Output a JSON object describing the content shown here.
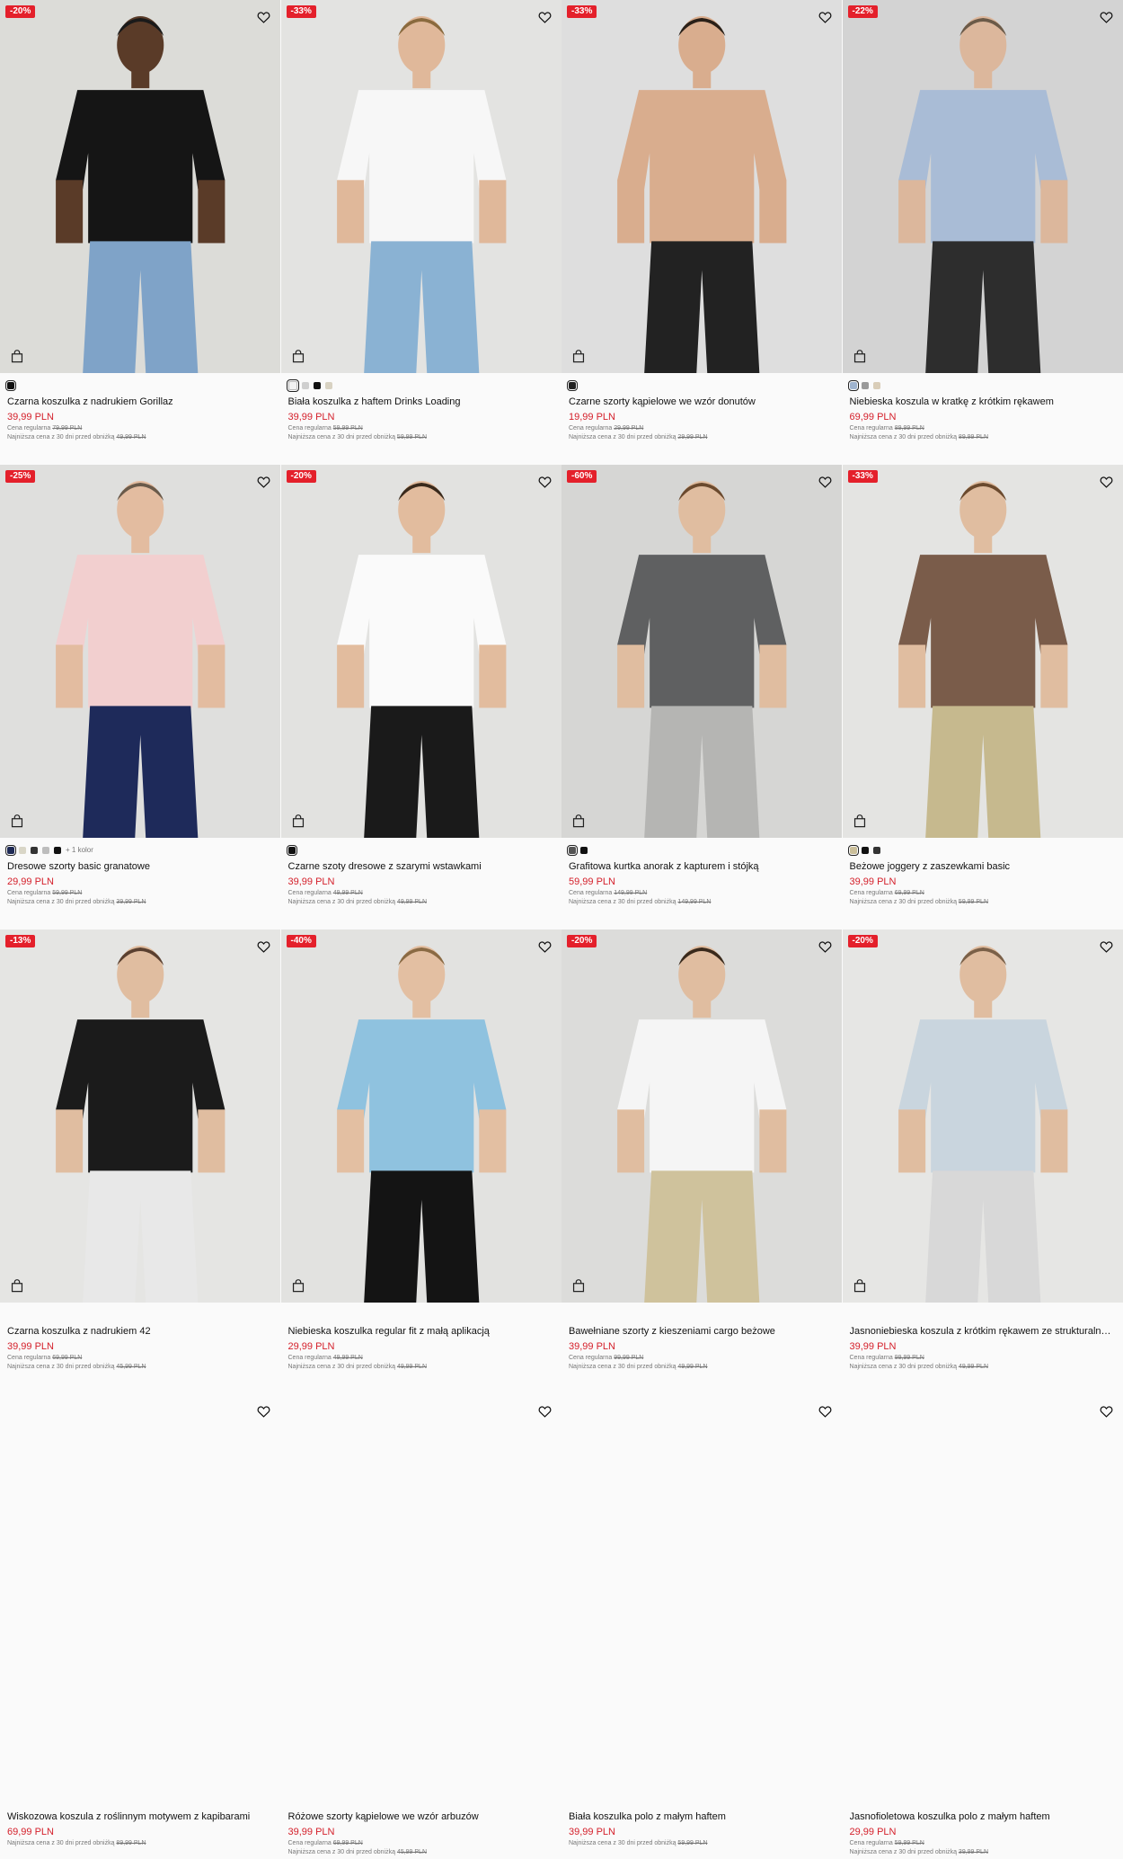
{
  "labels": {
    "regular": "Cena regularna",
    "lowest": "Najniższa cena z 30 dni przed obniżką"
  },
  "products": [
    {
      "badge": "-20%",
      "name": "Czarna koszulka z nadrukiem Gorillaz",
      "price": "39,99 PLN",
      "regular": "79,99 PLN",
      "lowest": "49,99 PLN",
      "swatches": [
        "#111111"
      ],
      "more": "",
      "bg": "#dcdcd8",
      "top": "#151515",
      "bottom": "#7fa3c8",
      "skin": "#5a3b28",
      "hair": "#1a1a1a"
    },
    {
      "badge": "-33%",
      "name": "Biała koszulka z haftem Drinks Loading",
      "price": "39,99 PLN",
      "regular": "59,99 PLN",
      "lowest": "59,99 PLN",
      "swatches": [
        "#f2f2f2",
        "#cfcfcf",
        "#111111",
        "#d8d2c2"
      ],
      "more": "",
      "bg": "#e3e3e1",
      "top": "#f7f7f7",
      "bottom": "#8ab2d3",
      "skin": "#e0b89a",
      "hair": "#8a6a3e"
    },
    {
      "badge": "-33%",
      "name": "Czarne szorty kąpielowe we wzór donutów",
      "price": "19,99 PLN",
      "regular": "29,99 PLN",
      "lowest": "29,99 PLN",
      "swatches": [
        "#222222"
      ],
      "more": "",
      "bg": "#dedede",
      "top": "#d9ad8e",
      "bottom": "#222222",
      "skin": "#d9ad8e",
      "hair": "#2a2018"
    },
    {
      "badge": "-22%",
      "name": "Niebieska koszula w kratkę z krótkim rękawem",
      "price": "69,99 PLN",
      "regular": "89,99 PLN",
      "lowest": "89,99 PLN",
      "swatches": [
        "#9fb4cf",
        "#9a9a9a",
        "#d9cdb8"
      ],
      "more": "",
      "bg": "#d3d3d3",
      "top": "#a9bcd6",
      "bottom": "#2d2d2d",
      "skin": "#dcb79c",
      "hair": "#6b5a48"
    },
    {
      "badge": "-25%",
      "name": "Dresowe szorty basic granatowe",
      "price": "29,99 PLN",
      "regular": "59,99 PLN",
      "lowest": "39,99 PLN",
      "swatches": [
        "#1e2a55",
        "#d9d6c7",
        "#333333",
        "#bdbdbd",
        "#111111"
      ],
      "more": "+ 1 kolor",
      "bg": "#dfdfdd",
      "top": "#f2cfcf",
      "bottom": "#1e2a5a",
      "skin": "#e3bca0",
      "hair": "#6a5a4a"
    },
    {
      "badge": "-20%",
      "name": "Czarne szoty dresowe z szarymi wstawkami",
      "price": "39,99 PLN",
      "regular": "49,99 PLN",
      "lowest": "49,99 PLN",
      "swatches": [
        "#111111"
      ],
      "more": "",
      "bg": "#e2e2e0",
      "top": "#fafafa",
      "bottom": "#1a1a1a",
      "skin": "#e2bc9e",
      "hair": "#3a2a1c"
    },
    {
      "badge": "-60%",
      "name": "Grafitowa kurtka anorak z kapturem i stójką",
      "price": "59,99 PLN",
      "regular": "149,99 PLN",
      "lowest": "149,99 PLN",
      "swatches": [
        "#555555",
        "#111111"
      ],
      "more": "",
      "bg": "#d6d6d4",
      "top": "#5f6061",
      "bottom": "#b5b5b3",
      "skin": "#e0bda0",
      "hair": "#6b4a2e"
    },
    {
      "badge": "-33%",
      "name": "Beżowe joggery z zaszewkami basic",
      "price": "39,99 PLN",
      "regular": "69,99 PLN",
      "lowest": "59,99 PLN",
      "swatches": [
        "#cbbf9a",
        "#111111",
        "#333333"
      ],
      "more": "",
      "bg": "#e4e4e2",
      "top": "#7a5c4a",
      "bottom": "#c6b98e",
      "skin": "#e0bda0",
      "hair": "#6b4a2e"
    },
    {
      "badge": "-13%",
      "name": "Czarna koszulka z nadrukiem 42",
      "price": "39,99 PLN",
      "regular": "69,99 PLN",
      "lowest": "45,99 PLN",
      "swatches": [],
      "more": "",
      "bg": "#e5e5e3",
      "top": "#1b1b1b",
      "bottom": "#e8e8e8",
      "skin": "#e0bda0",
      "hair": "#5a4030"
    },
    {
      "badge": "-40%",
      "name": "Niebieska koszulka regular fit z małą aplikacją",
      "price": "29,99 PLN",
      "regular": "49,99 PLN",
      "lowest": "49,99 PLN",
      "swatches": [],
      "more": "",
      "bg": "#e2e2e0",
      "top": "#8fc2df",
      "bottom": "#141414",
      "skin": "#e3bfa2",
      "hair": "#8a6a44"
    },
    {
      "badge": "-20%",
      "name": "Bawełniane szorty z kieszeniami cargo beżowe",
      "price": "39,99 PLN",
      "regular": "99,99 PLN",
      "lowest": "49,99 PLN",
      "swatches": [],
      "more": "",
      "bg": "#dcdcda",
      "top": "#f5f5f5",
      "bottom": "#cfc29c",
      "skin": "#e0bda0",
      "hair": "#3a2a1c"
    },
    {
      "badge": "-20%",
      "name": "Jasnoniebieska koszula z krótkim rękawem ze strukturalną tkaniną",
      "price": "39,99 PLN",
      "regular": "99,99 PLN",
      "lowest": "49,99 PLN",
      "swatches": [],
      "more": "",
      "bg": "#e6e6e4",
      "top": "#c9d5de",
      "bottom": "#d8d8d8",
      "skin": "#e0bda0",
      "hair": "#7a6048"
    },
    {
      "badge": "",
      "name": "Wiskozowa koszula z roślinnym motywem z kapibarami",
      "price": "69,99 PLN",
      "regular": "",
      "lowest": "89,99 PLN",
      "swatches": [],
      "more": "",
      "bg": "",
      "top": "",
      "bottom": "",
      "skin": "",
      "hair": ""
    },
    {
      "badge": "",
      "name": "Różowe szorty kąpielowe we wzór arbuzów",
      "price": "39,99 PLN",
      "regular": "69,99 PLN",
      "lowest": "45,99 PLN",
      "swatches": [],
      "more": "",
      "bg": "",
      "top": "",
      "bottom": "",
      "skin": "",
      "hair": ""
    },
    {
      "badge": "",
      "name": "Biała koszulka polo z małym haftem",
      "price": "39,99 PLN",
      "regular": "",
      "lowest": "59,99 PLN",
      "swatches": [],
      "more": "",
      "bg": "",
      "top": "",
      "bottom": "",
      "skin": "",
      "hair": ""
    },
    {
      "badge": "",
      "name": "Jasnofioletowa koszulka polo z małym haftem",
      "price": "29,99 PLN",
      "regular": "59,99 PLN",
      "lowest": "39,99 PLN",
      "swatches": [],
      "more": "",
      "bg": "",
      "top": "",
      "bottom": "",
      "skin": "",
      "hair": ""
    }
  ],
  "icons": {
    "wishlist": "heart-icon",
    "cart": "shopping-bag-icon"
  }
}
